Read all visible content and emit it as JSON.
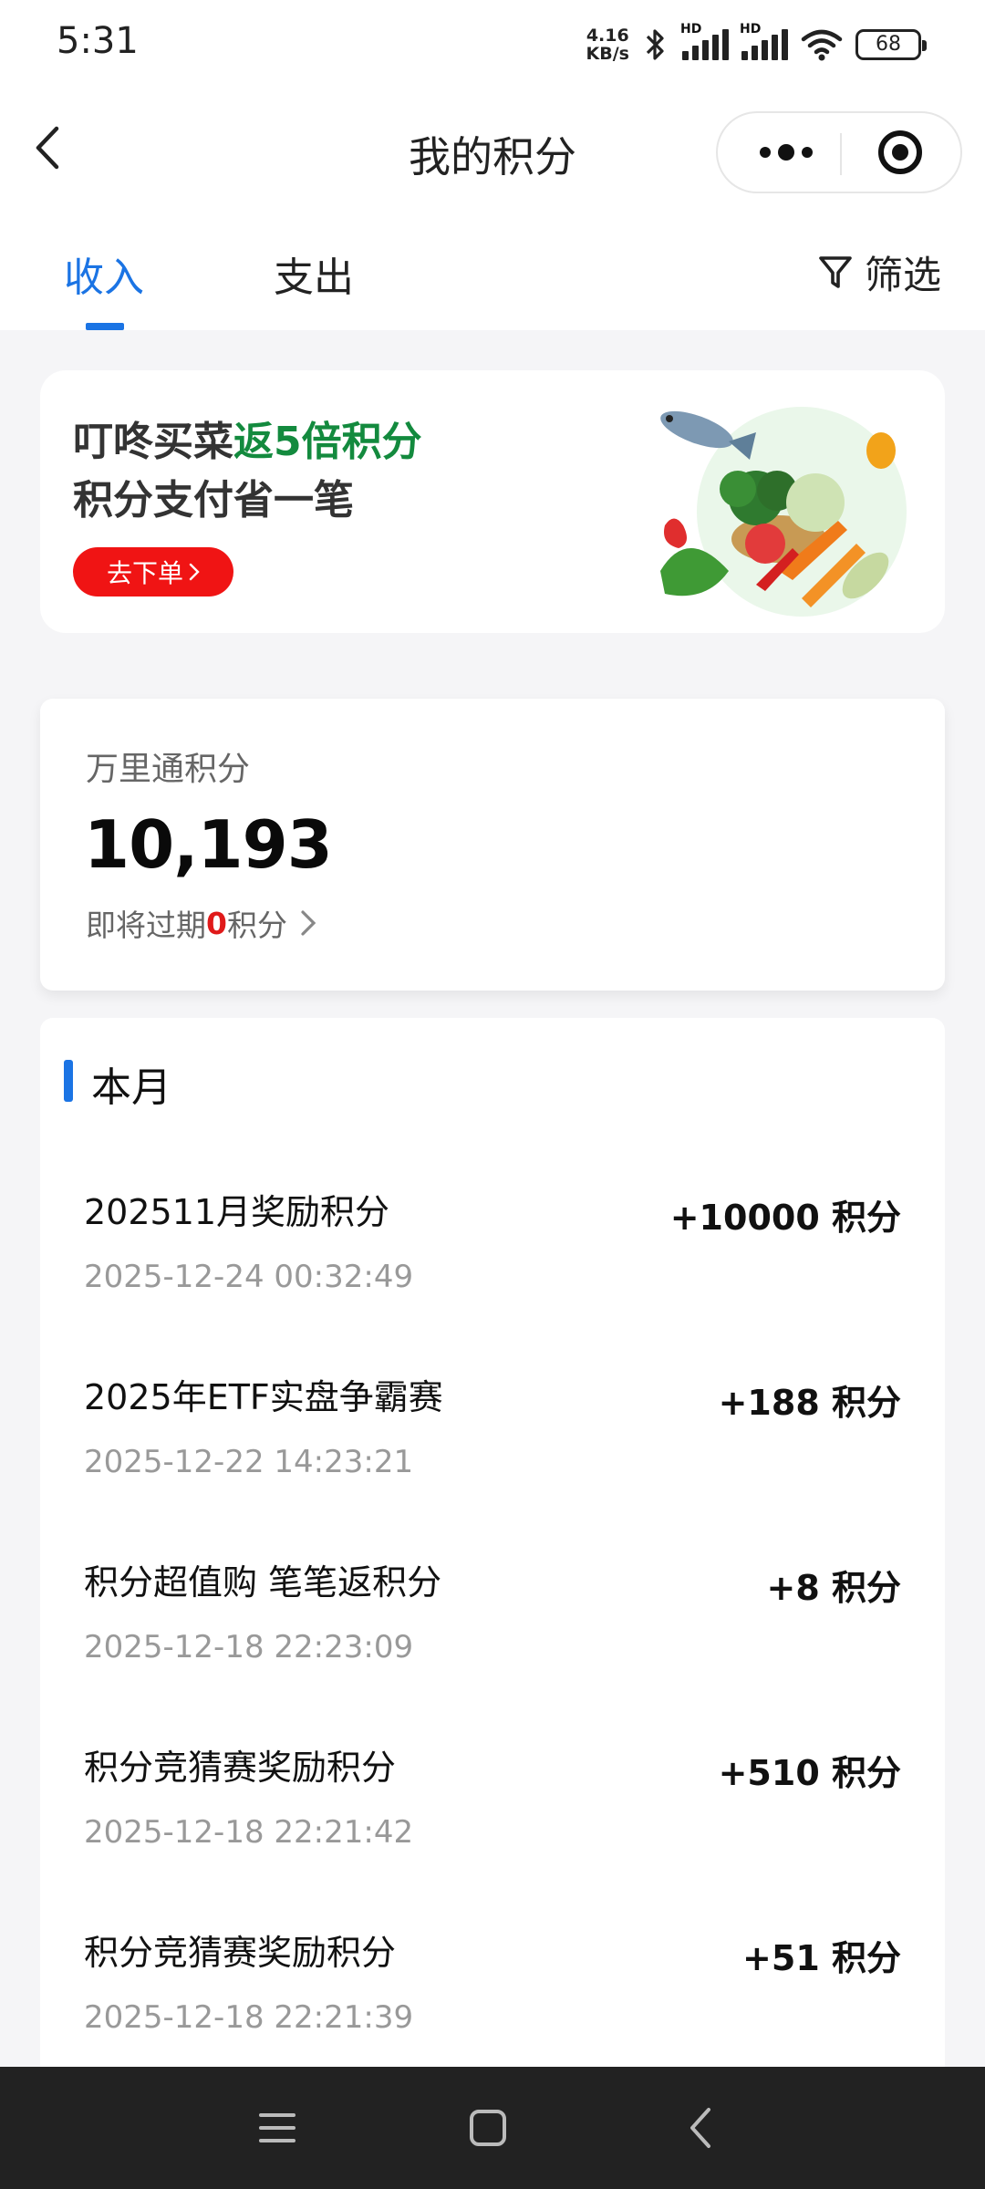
{
  "status_bar": {
    "time": "5:31",
    "net_speed_value": "4.16",
    "net_speed_unit": "KB/s",
    "hd_label": "HD",
    "battery": "68"
  },
  "nav": {
    "title": "我的积分"
  },
  "tabs": {
    "income": "收入",
    "expense": "支出",
    "filter": "筛选",
    "active": "income"
  },
  "promo": {
    "line1_prefix": "叮咚买菜",
    "line1_highlight": "返5倍积分",
    "line2": "积分支付省一笔",
    "button": "去下单",
    "highlight_color": "#138a3e",
    "button_color": "#f01414"
  },
  "points": {
    "label": "万里通积分",
    "value": "10,193",
    "expire_prefix": "即将过期",
    "expire_count": "0",
    "expire_suffix": "积分"
  },
  "records": {
    "section_title": "本月",
    "items": [
      {
        "title": "202511月奖励积分",
        "time": "2025-12-24 00:32:49",
        "amount": "+10000 积分"
      },
      {
        "title": "2025年ETF实盘争霸赛",
        "time": "2025-12-22 14:23:21",
        "amount": "+188 积分"
      },
      {
        "title": "积分超值购 笔笔返积分",
        "time": "2025-12-18 22:23:09",
        "amount": "+8 积分"
      },
      {
        "title": "积分竞猜赛奖励积分",
        "time": "2025-12-18 22:21:42",
        "amount": "+510 积分"
      },
      {
        "title": "积分竞猜赛奖励积分",
        "time": "2025-12-18 22:21:39",
        "amount": "+51 积分"
      }
    ]
  },
  "colors": {
    "accent": "#1b74e4",
    "expire_highlight": "#e01a1a"
  }
}
